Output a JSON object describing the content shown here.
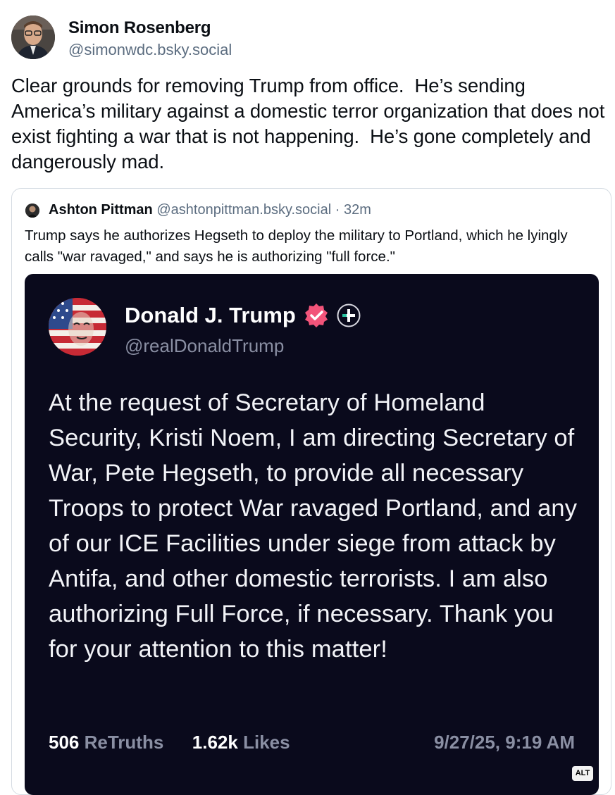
{
  "post": {
    "author_name": "Simon Rosenberg",
    "author_handle": "@simonwdc.bsky.social",
    "avatar_icon": "author-avatar-photo",
    "text": "Clear grounds for removing Trump from office.  He’s sending America’s military against a domestic terror organization that does not exist fighting a war that is not happening.  He’s gone completely and dangerously mad."
  },
  "quote": {
    "author_name": "Ashton Pittman",
    "author_handle": "@ashtonpittman.bsky.social",
    "separator": "·",
    "time": "32m",
    "text": "Trump says he authorizes Hegseth to deploy the military to Portland, which he lyingly calls \"war ravaged,\" and says he is authorizing \"full force.\""
  },
  "embed": {
    "name": "Donald J. Trump",
    "handle": "@realDonaldTrump",
    "verified_icon": "verified-badge-icon",
    "plus_icon": "plus-badge-icon",
    "text": "At the request of Secretary of Homeland Security, Kristi Noem, I am directing Secretary of War, Pete Hegseth, to provide all necessary Troops to protect War ravaged Portland, and any of our ICE Facilities under siege from attack by Antifa, and other domestic terrorists. I am also authorizing Full Force, if necessary. Thank you for your attention to this matter!",
    "retruths_count": "506",
    "retruths_label": "ReTruths",
    "likes_count": "1.62k",
    "likes_label": "Likes",
    "timestamp": "9/27/25, 9:19 AM",
    "alt_badge": "ALT"
  },
  "colors": {
    "text": "#0b0f14",
    "muted": "#5c6d80",
    "embed_bg": "#0a0a1c",
    "verified": "#f2547a"
  }
}
